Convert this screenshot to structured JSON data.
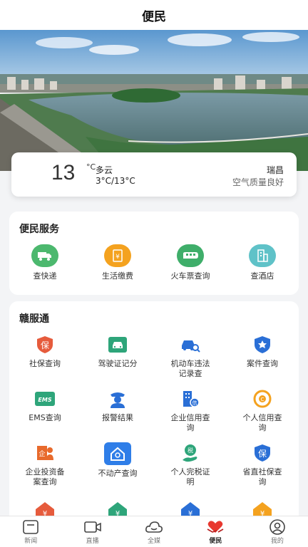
{
  "header": {
    "title": "便民"
  },
  "weather": {
    "temperature": "13",
    "unit": "°C",
    "condition": "多云",
    "range": "3°C/13°C",
    "city": "瑞昌",
    "air_quality": "空气质量良好"
  },
  "services": {
    "title": "便民服务",
    "items": [
      {
        "label": "查快递",
        "icon": "truck-icon",
        "color": "#4cb86e"
      },
      {
        "label": "生活缴费",
        "icon": "bill-icon",
        "color": "#f4a21f"
      },
      {
        "label": "火车票查询",
        "icon": "train-icon",
        "color": "#3fae6a"
      },
      {
        "label": "查酒店",
        "icon": "hotel-icon",
        "color": "#5fc2c8"
      }
    ]
  },
  "ganfutong": {
    "title": "赣服通",
    "items": [
      {
        "label": "社保查询",
        "icon": "social-security-icon",
        "color": "#e65b3c"
      },
      {
        "label": "驾驶证记分",
        "icon": "car-icon",
        "color": "#2ea57a"
      },
      {
        "label": "机动车违法记录查",
        "icon": "vehicle-search-icon",
        "color": "#2a6fd6"
      },
      {
        "label": "案件查询",
        "icon": "police-badge-icon",
        "color": "#2a6fd6"
      },
      {
        "label": "EMS查询",
        "icon": "ems-icon",
        "color": "#2ea57a"
      },
      {
        "label": "报警结果",
        "icon": "police-officer-icon",
        "color": "#2a6fd6"
      },
      {
        "label": "企业信用查询",
        "icon": "building-credit-icon",
        "color": "#2a6fd6"
      },
      {
        "label": "个人信用查询",
        "icon": "personal-credit-icon",
        "color": "#f4a21f"
      },
      {
        "label": "企业投资备案查询",
        "icon": "investment-icon",
        "color": "#e86a2c"
      },
      {
        "label": "不动产查询",
        "icon": "real-estate-icon",
        "color": "#2f7ee8"
      },
      {
        "label": "个人完税证明",
        "icon": "tax-icon",
        "color": "#2ea57a"
      },
      {
        "label": "省直社保查询",
        "icon": "shield-icon",
        "color": "#2a6fd6"
      },
      {
        "label": "",
        "icon": "house-yuan-icon",
        "color": "#e65b3c"
      },
      {
        "label": "",
        "icon": "house-yuan-icon",
        "color": "#2ea57a"
      },
      {
        "label": "",
        "icon": "house-yuan-icon",
        "color": "#2a6fd6"
      },
      {
        "label": "",
        "icon": "house-yuan-icon",
        "color": "#f4a21f"
      }
    ]
  },
  "tabbar": {
    "items": [
      {
        "label": "新闻",
        "icon": "news-icon"
      },
      {
        "label": "直播",
        "icon": "video-icon"
      },
      {
        "label": "全媒",
        "icon": "cloud-icon"
      },
      {
        "label": "便民",
        "icon": "heart-hands-icon",
        "active": true
      },
      {
        "label": "我的",
        "icon": "user-icon"
      }
    ]
  }
}
